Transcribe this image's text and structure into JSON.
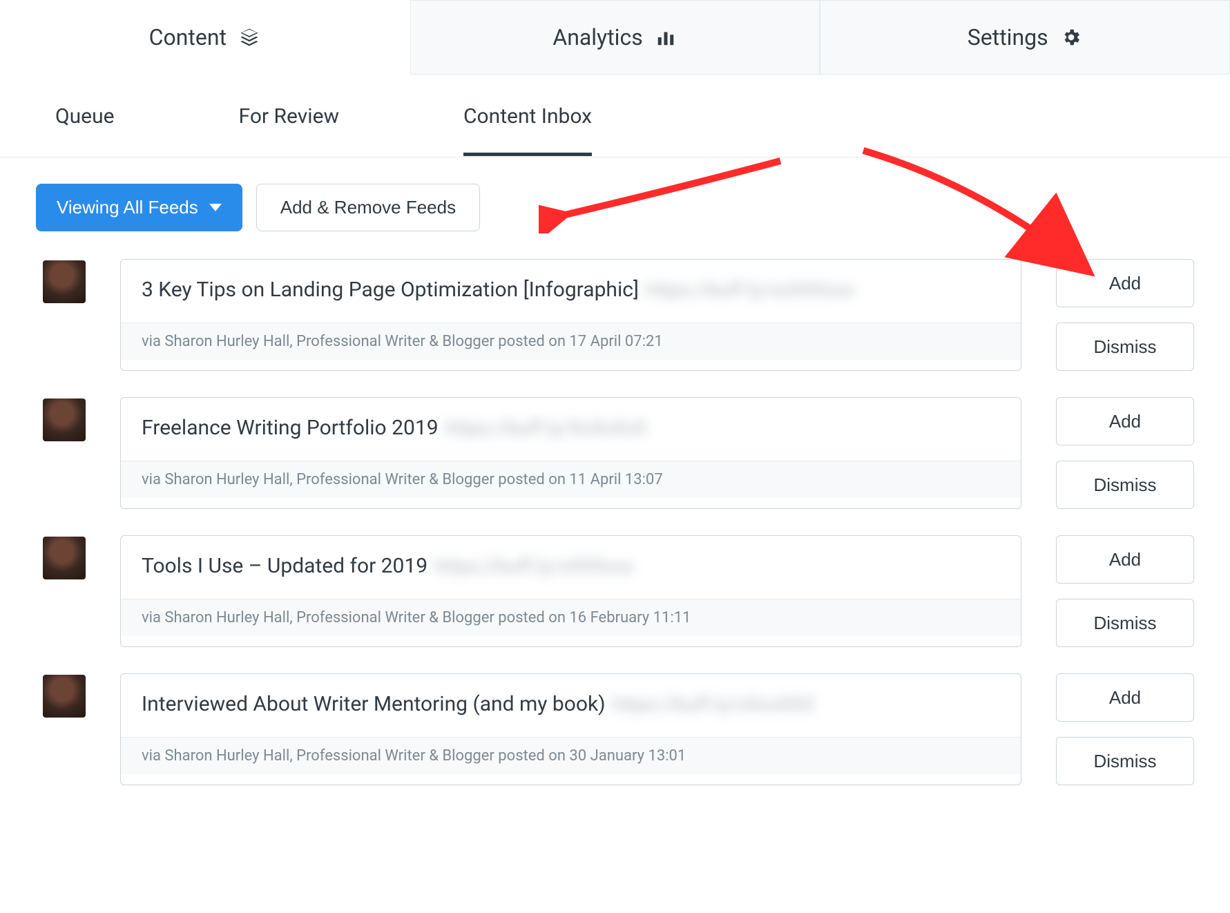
{
  "topnav": {
    "content": "Content",
    "analytics": "Analytics",
    "settings": "Settings"
  },
  "subnav": {
    "queue": "Queue",
    "for_review": "For Review",
    "content_inbox": "Content Inbox"
  },
  "controls": {
    "viewing": "Viewing All Feeds",
    "add_remove": "Add & Remove Feeds"
  },
  "buttons": {
    "add": "Add",
    "dismiss": "Dismiss"
  },
  "items": [
    {
      "title": "3 Key Tips on Landing Page Optimization [Infographic]",
      "link_obscured": "https://buff.ly/xxXXXxxx",
      "meta": "via Sharon Hurley Hall, Professional Writer & Blogger posted on 17 April 07:21"
    },
    {
      "title": "Freelance Writing Portfolio 2019",
      "link_obscured": "https://buff.ly/XxXxXxX",
      "meta": "via Sharon Hurley Hall, Professional Writer & Blogger posted on 11 April 13:07"
    },
    {
      "title": "Tools I Use – Updated for 2019",
      "link_obscured": "https://buff.ly/xXXXxxx",
      "meta": "via Sharon Hurley Hall, Professional Writer & Blogger posted on 16 February 11:11"
    },
    {
      "title": "Interviewed About Writer Mentoring (and my book)",
      "link_obscured": "https://buff.ly/xXxxXXX",
      "meta": "via Sharon Hurley Hall, Professional Writer & Blogger posted on 30 January 13:01"
    }
  ]
}
